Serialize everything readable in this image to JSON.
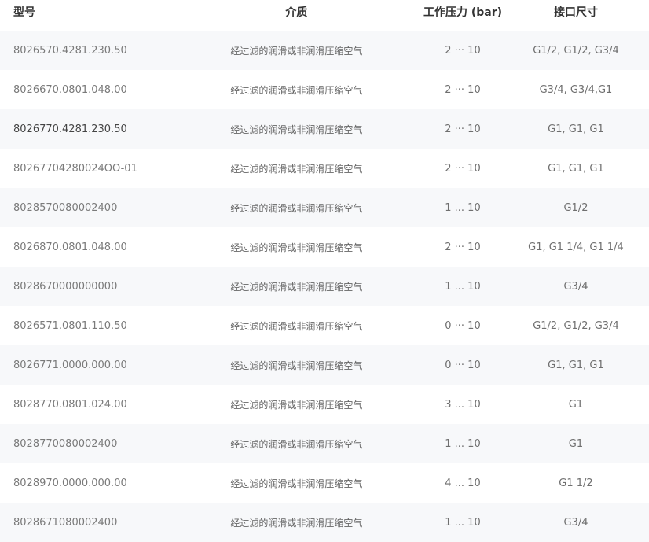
{
  "table": {
    "headers": {
      "model": "型号",
      "media": "介质",
      "pressure": "工作压力 (bar)",
      "port": "接口尺寸"
    },
    "rows": [
      {
        "model": "8026570.4281.230.50",
        "media": "经过滤的润滑或非润滑压缩空气",
        "pressure": "2 ··· 10",
        "port": "G1/2, G1/2, G3/4"
      },
      {
        "model": "8026670.0801.048.00",
        "media": "经过滤的润滑或非润滑压缩空气",
        "pressure": "2 ··· 10",
        "port": "G3/4, G3/4,G1"
      },
      {
        "model": "8026770.4281.230.50",
        "media": "经过滤的润滑或非润滑压缩空气",
        "pressure": "2 ··· 10",
        "port": "G1, G1, G1"
      },
      {
        "model": "80267704280024OO-01",
        "media": "经过滤的润滑或非润滑压缩空气",
        "pressure": "2 ··· 10",
        "port": "G1, G1, G1"
      },
      {
        "model": "8028570080002400",
        "media": "经过滤的润滑或非润滑压缩空气",
        "pressure": "1 ... 10",
        "port": "G1/2"
      },
      {
        "model": "8026870.0801.048.00",
        "media": "经过滤的润滑或非润滑压缩空气",
        "pressure": "2 ··· 10",
        "port": "G1, G1 1/4, G1 1/4"
      },
      {
        "model": "8028670000000000",
        "media": "经过滤的润滑或非润滑压缩空气",
        "pressure": "1 ... 10",
        "port": "G3/4"
      },
      {
        "model": "8026571.0801.110.50",
        "media": "经过滤的润滑或非润滑压缩空气",
        "pressure": "0 ··· 10",
        "port": "G1/2, G1/2, G3/4"
      },
      {
        "model": "8026771.0000.000.00",
        "media": "经过滤的润滑或非润滑压缩空气",
        "pressure": "0 ··· 10",
        "port": "G1, G1, G1"
      },
      {
        "model": "8028770.0801.024.00",
        "media": "经过滤的润滑或非润滑压缩空气",
        "pressure": "3 ... 10",
        "port": "G1"
      },
      {
        "model": "8028770080002400",
        "media": "经过滤的润滑或非润滑压缩空气",
        "pressure": "1 ... 10",
        "port": "G1"
      },
      {
        "model": "8028970.0000.000.00",
        "media": "经过滤的润滑或非润滑压缩空气",
        "pressure": "4 ... 10",
        "port": "G1 1/2"
      },
      {
        "model": "8028671080002400",
        "media": "经过滤的润滑或非润滑压缩空气",
        "pressure": "1 ... 10",
        "port": "G3/4"
      }
    ]
  },
  "colors": {
    "header_text": "#333333",
    "cell_text": "#757575",
    "stripe_background": "#f7f8fa"
  }
}
